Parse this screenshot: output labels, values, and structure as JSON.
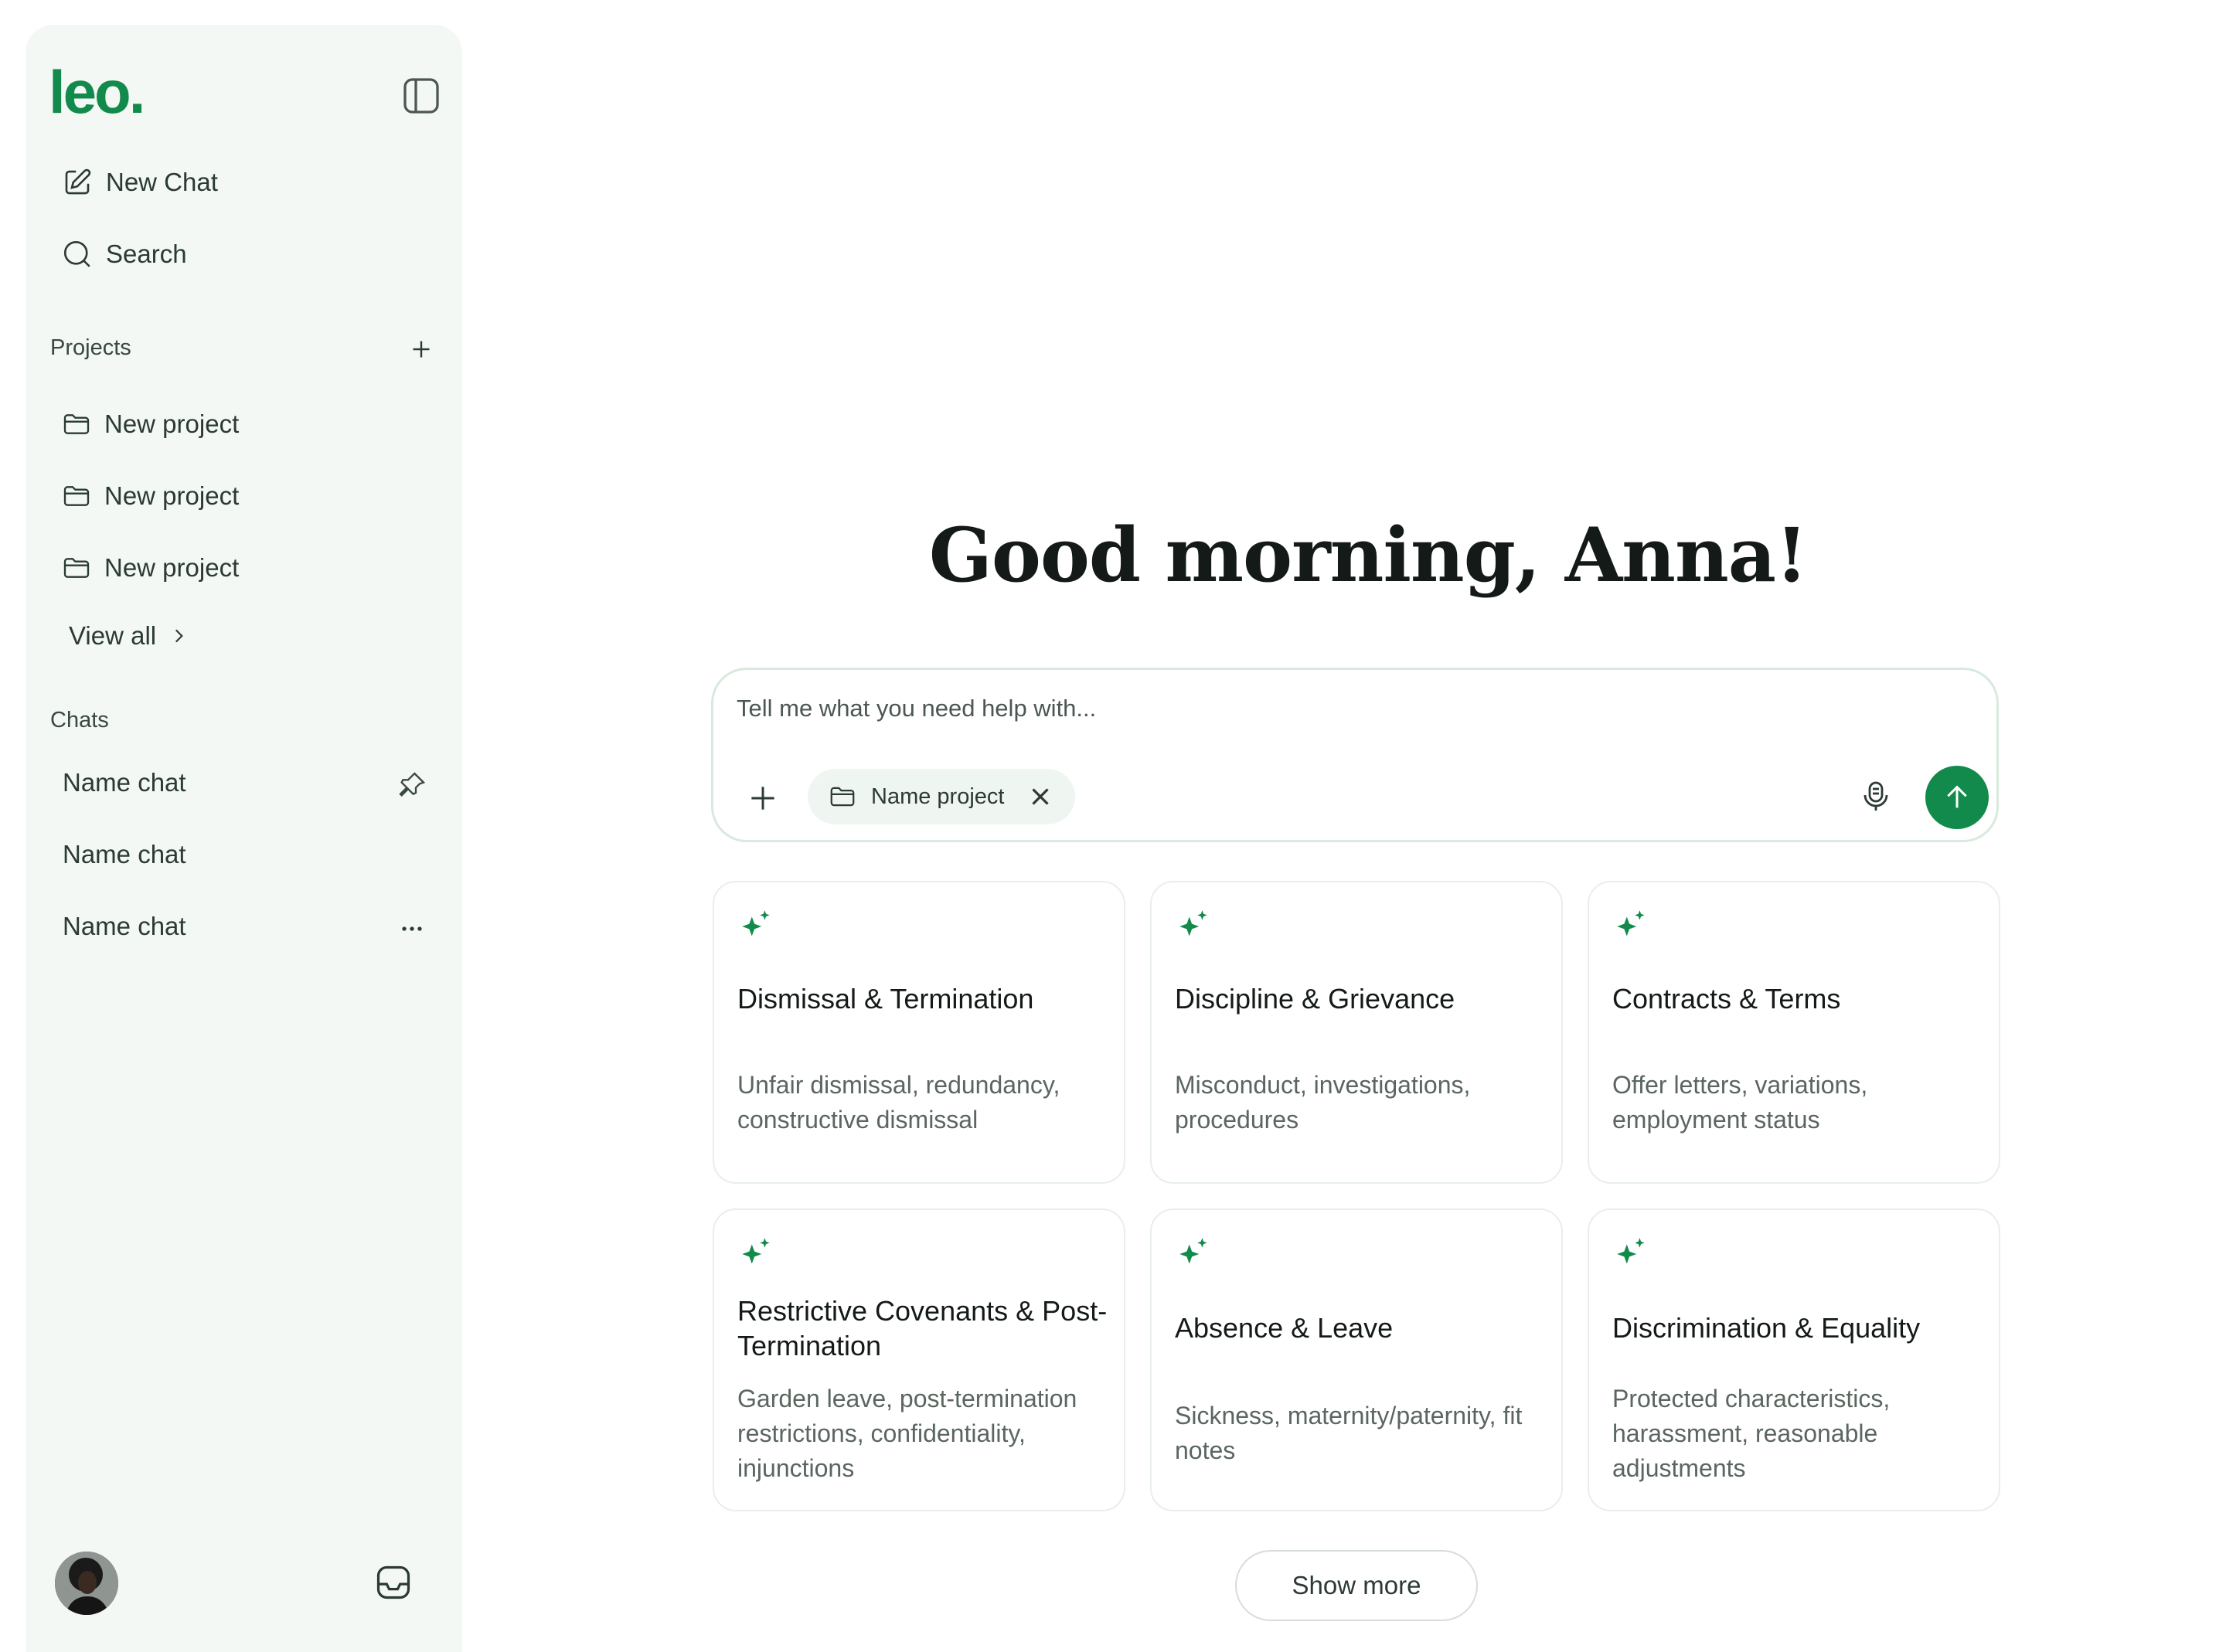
{
  "brand": {
    "logo_text": "leo.",
    "accent": "#128a4c"
  },
  "sidebar": {
    "new_chat": "New Chat",
    "search": "Search",
    "projects_label": "Projects",
    "projects": [
      "New project",
      "New project",
      "New project"
    ],
    "view_all": "View all",
    "chats_label": "Chats",
    "chats": [
      "Name chat",
      "Name chat",
      "Name chat"
    ]
  },
  "main": {
    "greeting": "Good morning, Anna!",
    "composer": {
      "placeholder": "Tell me what you need help with...",
      "chip_label": "Name project"
    },
    "cards": [
      {
        "title": "Dismissal & Termination",
        "desc": "Unfair dismissal, redundancy, constructive dismissal"
      },
      {
        "title": "Discipline & Grievance",
        "desc": "Misconduct, investigations, procedures"
      },
      {
        "title": "Contracts & Terms",
        "desc": "Offer letters, variations, employment status"
      },
      {
        "title": "Restrictive Covenants & Post-Termination",
        "desc": "Garden leave, post-termination restrictions, confidentiality, injunctions"
      },
      {
        "title": "Absence & Leave",
        "desc": "Sickness, maternity/paternity, fit notes"
      },
      {
        "title": "Discrimination & Equality",
        "desc": "Protected characteristics, harassment, reasonable adjustments"
      }
    ],
    "show_more": "Show more"
  }
}
